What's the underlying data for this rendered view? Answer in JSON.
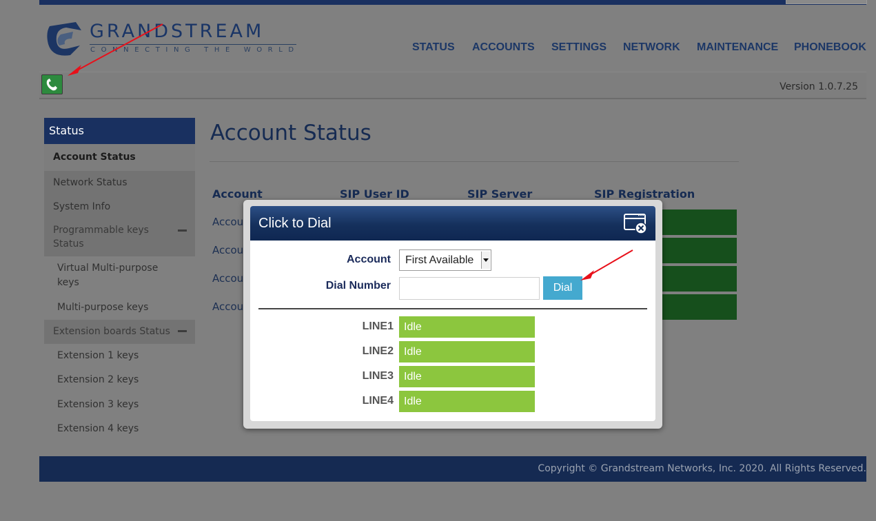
{
  "header": {
    "brand_name": "GRANDSTREAM",
    "brand_tagline": "CONNECTING THE WORLD",
    "nav": [
      "STATUS",
      "ACCOUNTS",
      "SETTINGS",
      "NETWORK",
      "MAINTENANCE",
      "PHONEBOOK"
    ],
    "version": "Version 1.0.7.25",
    "phone_icon": "phone-icon"
  },
  "sidebar": {
    "heading": "Status",
    "items": [
      {
        "label": "Account Status"
      },
      {
        "label": "Network Status"
      },
      {
        "label": "System Info"
      },
      {
        "label": "Programmable keys Status"
      },
      {
        "label": "Virtual Multi-purpose keys"
      },
      {
        "label": "Multi-purpose keys"
      },
      {
        "label": "Extension boards Status"
      },
      {
        "label": "Extension 1 keys"
      },
      {
        "label": "Extension 2 keys"
      },
      {
        "label": "Extension 3 keys"
      },
      {
        "label": "Extension 4 keys"
      }
    ]
  },
  "main": {
    "title": "Account Status",
    "columns": [
      "Account",
      "SIP User ID",
      "SIP Server",
      "SIP Registration"
    ],
    "rows": [
      "Account",
      "Account",
      "Account",
      "Account"
    ]
  },
  "dialog": {
    "title": "Click to Dial",
    "account_label": "Account",
    "account_value": "First Available",
    "dial_number_label": "Dial Number",
    "dial_number_value": "",
    "dial_button": "Dial",
    "lines": [
      {
        "name": "LINE1",
        "status": "Idle"
      },
      {
        "name": "LINE2",
        "status": "Idle"
      },
      {
        "name": "LINE3",
        "status": "Idle"
      },
      {
        "name": "LINE4",
        "status": "Idle"
      }
    ]
  },
  "footer": {
    "copyright": "Copyright © Grandstream Networks, Inc. 2020. All Rights Reserved."
  },
  "colors": {
    "brand_navy": "#1a3060",
    "line_idle": "#8cc63e",
    "dial_button": "#44a9cf",
    "registration_ok": "#164f1c",
    "annotation_arrow": "#e8101a"
  }
}
